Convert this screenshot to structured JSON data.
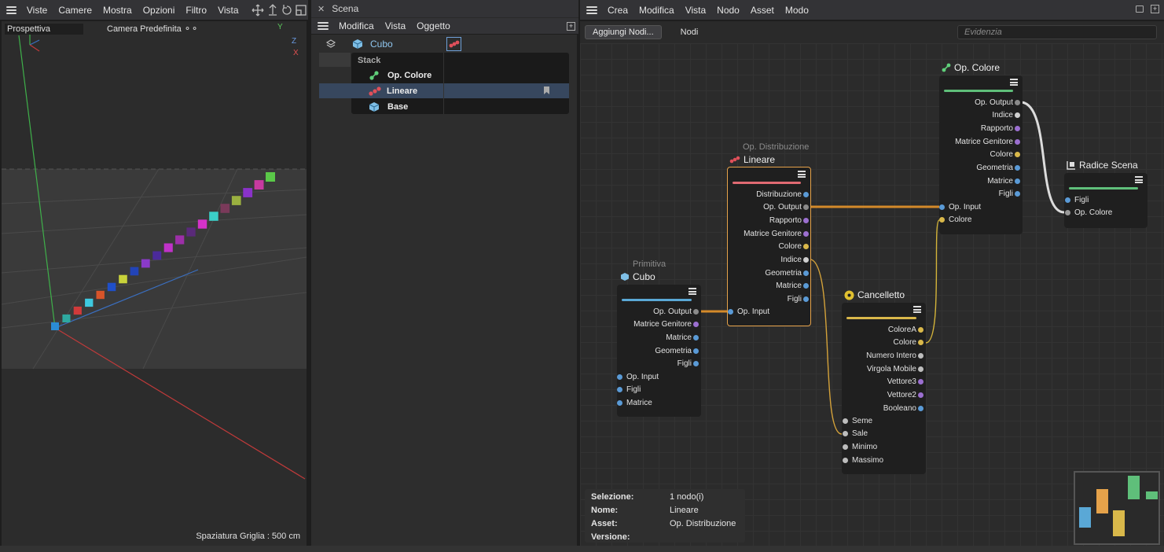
{
  "viewport": {
    "menu": [
      "Viste",
      "Camere",
      "Mostra",
      "Opzioni",
      "Filtro",
      "Vista"
    ],
    "view_name": "Prospettiva",
    "camera": "Camera Predefinita",
    "grid_spacing": "Spaziatura Griglia : 500 cm",
    "axis_labels": {
      "y": "Y",
      "z": "Z",
      "x": "X"
    },
    "clone_colors": [
      "#2b8cd4",
      "#2ea9a0",
      "#d03a3a",
      "#3ec9e0",
      "#d7542a",
      "#1f4fc8",
      "#c8d23a",
      "#2244b8",
      "#8a3ac9",
      "#4b2a9b",
      "#c032c9",
      "#9d2fa8",
      "#5a2a7a",
      "#d432c9",
      "#3bd0c8",
      "#7a3a5a",
      "#9ab040",
      "#8a32c9",
      "#c83aa0",
      "#5ac848"
    ]
  },
  "scene": {
    "title": "Scena",
    "menu": [
      "Modifica",
      "Vista",
      "Oggetto"
    ],
    "object": "Cubo",
    "stack_label": "Stack",
    "stack_items": [
      "Op. Colore",
      "Lineare",
      "Base"
    ]
  },
  "node_editor": {
    "menu": [
      "Crea",
      "Modifica",
      "Vista",
      "Nodo",
      "Asset",
      "Modo"
    ],
    "add_nodes": "Aggiungi Nodi...",
    "nodes_label": "Nodi",
    "search_placeholder": "Evidenzia",
    "nodes": {
      "cubo": {
        "sub": "Primitiva",
        "title": "Cubo",
        "bar": "#5aa8d6",
        "outputs": [
          "Op. Output",
          "Matrice Genitore",
          "Matrice",
          "Geometria",
          "Figli"
        ],
        "inputs": [
          "Op. Input",
          "Figli",
          "Matrice"
        ]
      },
      "lineare": {
        "sub": "Op. Distribuzione",
        "title": "Lineare",
        "bar": "#e06a72",
        "outputs": [
          "Distribuzione",
          "Op. Output",
          "Rapporto",
          "Matrice Genitore",
          "Colore",
          "Indice",
          "Geometria",
          "Matrice",
          "Figli"
        ],
        "inputs": [
          "Op. Input"
        ]
      },
      "cancelletto": {
        "title": "Cancelletto",
        "bar": "#d9b84a",
        "outputs": [
          "ColoreA",
          "Colore",
          "Numero Intero",
          "Virgola Mobile",
          "Vettore3",
          "Vettore2",
          "Booleano"
        ],
        "inputs": [
          "Seme",
          "Sale",
          "Minimo",
          "Massimo"
        ]
      },
      "opcolore": {
        "title": "Op. Colore",
        "bar": "#5fbf7a",
        "outputs": [
          "Op. Output",
          "Indice",
          "Rapporto",
          "Matrice Genitore",
          "Colore",
          "Geometria",
          "Matrice",
          "Figli"
        ],
        "inputs": [
          "Op. Input",
          "Colore"
        ]
      },
      "radice": {
        "title": "Radice Scena",
        "bar": "#5fbf7a",
        "inputs": [
          "Figli",
          "Op. Colore"
        ]
      }
    },
    "info": {
      "keys": [
        "Selezione:",
        "Nome:",
        "Asset:",
        "Versione:"
      ],
      "values": [
        "1 nodo(i)",
        "Lineare",
        "Op. Distribuzione",
        ""
      ]
    }
  }
}
